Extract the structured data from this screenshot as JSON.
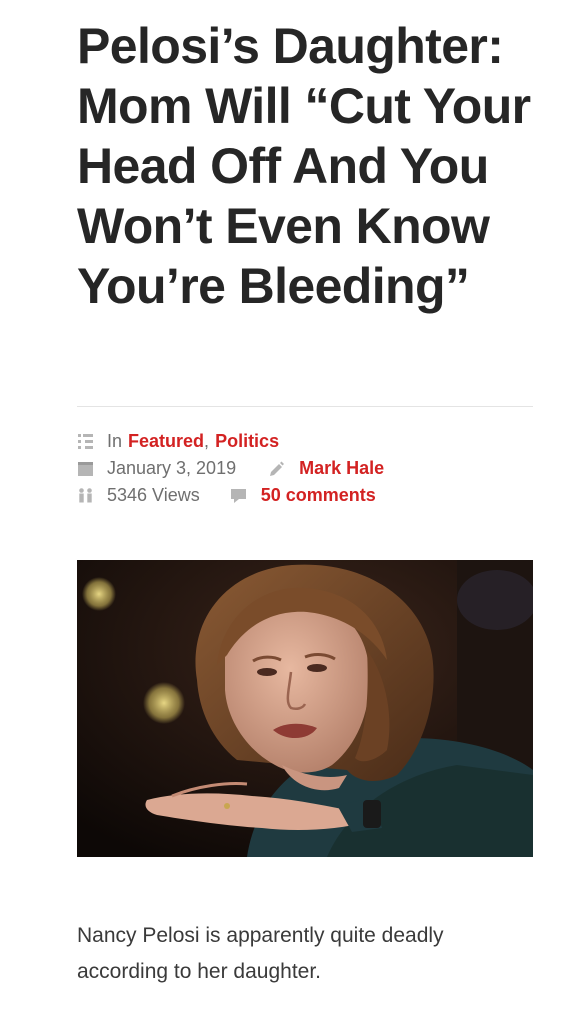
{
  "article": {
    "title": "Pelosi’s Daughter: Mom Will “Cut Your Head Off And You Won’t Even Know You’re Bleeding”",
    "meta": {
      "in_prefix": "In",
      "categories": [
        "Featured",
        "Politics"
      ],
      "category_separator": ",",
      "date": "January 3, 2019",
      "author": "Mark Hale",
      "views": "5346 Views",
      "comments": "50 comments"
    },
    "image_alt": "",
    "body_paragraph": "Nancy Pelosi is apparently quite deadly according to her daughter."
  },
  "icons": {
    "category": "category-list-icon",
    "date": "calendar-icon",
    "author": "pencil-icon",
    "views": "people-icon",
    "comments": "comment-bubble-icon"
  },
  "colors": {
    "link_red": "#d32222",
    "meta_gray": "#6f6f6f",
    "title": "#262626",
    "icon_gray": "#b5b5b5"
  }
}
